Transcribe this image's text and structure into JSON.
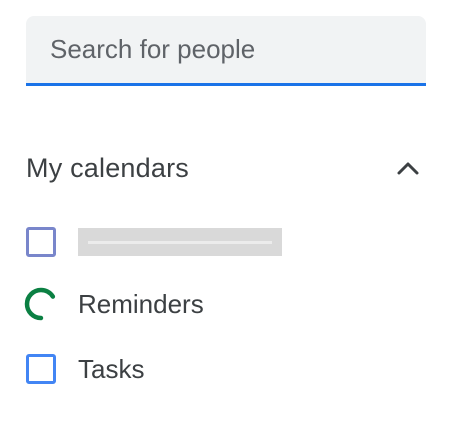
{
  "search": {
    "placeholder": "Search for people",
    "value": ""
  },
  "my_calendars": {
    "title": "My calendars",
    "collapse_icon": "chevron-up-icon",
    "items": [
      {
        "label": "",
        "redacted": true,
        "color": "#7986cb",
        "checked": false,
        "icon": "checkbox"
      },
      {
        "label": "Reminders",
        "color": "#0b8043",
        "checked": false,
        "icon": "loading-ring"
      },
      {
        "label": "Tasks",
        "color": "#4285f4",
        "checked": false,
        "icon": "checkbox"
      }
    ]
  },
  "colors": {
    "accent": "#1a73e8",
    "search_bg": "#f1f3f4",
    "text": "#3c4043"
  }
}
